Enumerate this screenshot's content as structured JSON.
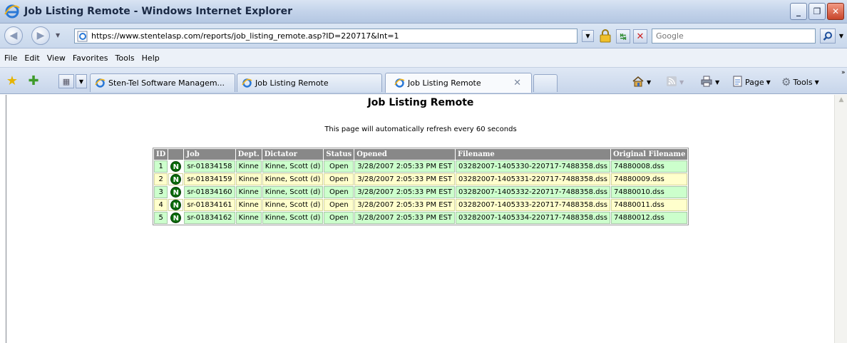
{
  "window": {
    "title": "Job Listing Remote - Windows Internet Explorer"
  },
  "address": {
    "url": "https://www.stentelasp.com/reports/job_listing_remote.asp?ID=220717&Int=1",
    "search_placeholder": "Google"
  },
  "menu": {
    "items": [
      "File",
      "Edit",
      "View",
      "Favorites",
      "Tools",
      "Help"
    ]
  },
  "tabs": {
    "items": [
      {
        "label": "Sten-Tel Software Managem..."
      },
      {
        "label": "Job Listing Remote"
      },
      {
        "label": "Job Listing Remote"
      }
    ]
  },
  "commands": {
    "page": "Page",
    "tools": "Tools"
  },
  "page": {
    "title": "Job Listing Remote",
    "refresh_note": "This page will automatically refresh every 60 seconds"
  },
  "table": {
    "headers": [
      "ID",
      "",
      "Job",
      "Dept.",
      "Dictator",
      "Status",
      "Opened",
      "Filename",
      "Original Filename"
    ],
    "rows": [
      {
        "id": "1",
        "icon": "N",
        "job": "sr-01834158",
        "dept": "Kinne",
        "dictator": "Kinne, Scott (d)",
        "status": "Open",
        "opened": "3/28/2007 2:05:33 PM EST",
        "filename": "03282007-1405330-220717-7488358.dss",
        "original": "74880008.dss"
      },
      {
        "id": "2",
        "icon": "N",
        "job": "sr-01834159",
        "dept": "Kinne",
        "dictator": "Kinne, Scott (d)",
        "status": "Open",
        "opened": "3/28/2007 2:05:33 PM EST",
        "filename": "03282007-1405331-220717-7488358.dss",
        "original": "74880009.dss"
      },
      {
        "id": "3",
        "icon": "N",
        "job": "sr-01834160",
        "dept": "Kinne",
        "dictator": "Kinne, Scott (d)",
        "status": "Open",
        "opened": "3/28/2007 2:05:33 PM EST",
        "filename": "03282007-1405332-220717-7488358.dss",
        "original": "74880010.dss"
      },
      {
        "id": "4",
        "icon": "N",
        "job": "sr-01834161",
        "dept": "Kinne",
        "dictator": "Kinne, Scott (d)",
        "status": "Open",
        "opened": "3/28/2007 2:05:33 PM EST",
        "filename": "03282007-1405333-220717-7488358.dss",
        "original": "74880011.dss"
      },
      {
        "id": "5",
        "icon": "N",
        "job": "sr-01834162",
        "dept": "Kinne",
        "dictator": "Kinne, Scott (d)",
        "status": "Open",
        "opened": "3/28/2007 2:05:33 PM EST",
        "filename": "03282007-1405334-220717-7488358.dss",
        "original": "74880012.dss"
      }
    ]
  },
  "colors": {
    "row_even": "#ccffcc",
    "row_odd": "#ffffcc",
    "header_bg": "#888888",
    "new_icon": "#0a6b0a"
  }
}
